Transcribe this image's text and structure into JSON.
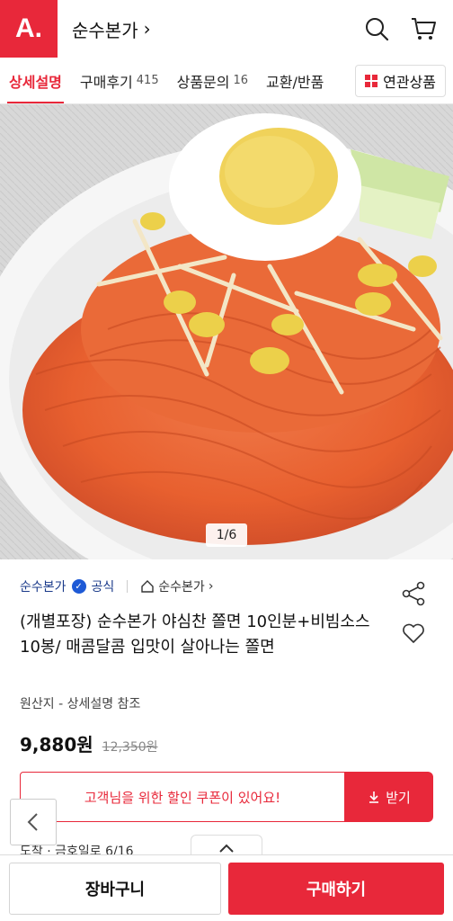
{
  "header": {
    "logo": "A.",
    "store_title": "순수본가",
    "chevron": "›",
    "search_icon": "search-icon",
    "cart_icon": "cart-icon"
  },
  "tabs": [
    {
      "label": "상세설명",
      "count": "",
      "active": true
    },
    {
      "label": "구매후기",
      "count": "415",
      "active": false
    },
    {
      "label": "상품문의",
      "count": "16",
      "active": false
    },
    {
      "label": "교환/반품",
      "count": "",
      "active": false
    }
  ],
  "related_button": {
    "label": "연관상품",
    "icon": "grid-icon"
  },
  "image": {
    "counter": "1/6"
  },
  "brand": {
    "name": "순수본가",
    "official_label": "공식",
    "store_link": "순수본가",
    "store_chevron": "›"
  },
  "product": {
    "title": "(개별포장) 순수본가 야심찬  쫄면 10인분+비빔소스10봉/ 매콤달콤 입맛이 살아나는 쫄면",
    "origin": "원산지 - 상세설명 참조",
    "price": "9,880원",
    "original_price": "12,350원"
  },
  "coupon": {
    "message": "고객님을 위한 할인 쿠폰이 있어요!",
    "button_label": "받기"
  },
  "delivery": {
    "text": "도착 · 금호일로 6/16"
  },
  "bottom_bar": {
    "cart_label": "장바구니",
    "buy_label": "구매하기"
  },
  "colors": {
    "accent": "#e8283a",
    "brand_blue": "#1a3a8a"
  }
}
